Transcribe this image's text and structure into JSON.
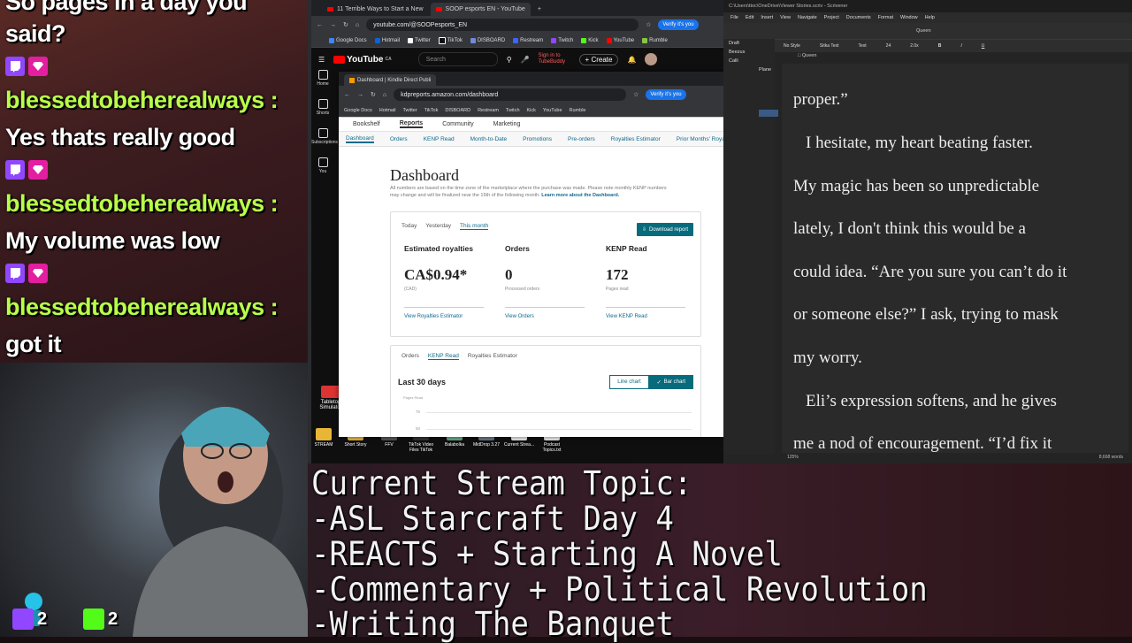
{
  "chat": {
    "partial_top": "So pages in a day you",
    "messages": [
      {
        "text_before": "said?"
      },
      {
        "user": "blessedtobeherealways :",
        "text": "Yes thats really good"
      },
      {
        "user": "blessedtobeherealways :",
        "text": "My volume was low"
      },
      {
        "user": "blessedtobeherealways :",
        "text": "got it"
      }
    ]
  },
  "stream_topic": {
    "lines": [
      "Current Stream Topic:",
      "-ASL Starcraft Day 4",
      "-REACTS + Starting A Novel",
      "-Commentary + Political Revolution",
      "-Writing The Banquet"
    ]
  },
  "stream_counts": {
    "twitch": "2",
    "kick": "2"
  },
  "youtube_browser": {
    "tabs": [
      "11 Terrible Ways to Start a New",
      "SOOP esports EN - YouTube"
    ],
    "url": "youtube.com/@SOOPesports_EN",
    "verify_label": "Verify it's you",
    "bookmarks": [
      "Google Docs",
      "Hotmail",
      "Twitter",
      "TikTok",
      "DISBOARD",
      "Restream",
      "Twitch",
      "Kick",
      "YouTube",
      "Rumble"
    ],
    "logo": "YouTube",
    "logo_region": "CA",
    "search_placeholder": "Search",
    "signin_text": "Sign in to TubeBuddy",
    "create_label": "Create",
    "sidebar": [
      "Home",
      "Shorts",
      "Subscriptions",
      "You"
    ]
  },
  "kdp_browser": {
    "tab_title": "Dashboard | Kindle Direct Publi",
    "url": "kdpreports.amazon.com/dashboard",
    "verify_label": "Verify it's you",
    "bookmarks": [
      "Google Docs",
      "Hotmail",
      "Twitter",
      "TikTok",
      "DISBOARD",
      "Restream",
      "Twitch",
      "Kick",
      "YouTube",
      "Rumble"
    ],
    "top_nav": [
      "Bookshelf",
      "Reports",
      "Community",
      "Marketing"
    ],
    "sub_nav": [
      "Dashboard",
      "Orders",
      "KENP Read",
      "Month-to-Date",
      "Promotions",
      "Pre-orders",
      "Royalties Estimator",
      "Prior Months' Royalties"
    ],
    "title": "Dashboard",
    "description": "All numbers are based on the time zone of the marketplace where the purchase was made. Please note monthly KENP numbers may change and will be finalized near the 15th of the following month.",
    "learn_more": "Learn more about the Dashboard.",
    "range_tabs": [
      "Today",
      "Yesterday",
      "This month"
    ],
    "download_label": "Download report",
    "metrics": [
      {
        "label": "Estimated royalties",
        "value": "CA$0.94*",
        "sub": "(CAD)",
        "link": "View Royalties Estimator"
      },
      {
        "label": "Orders",
        "value": "0",
        "sub": "Processed orders",
        "link": "View Orders"
      },
      {
        "label": "KENP Read",
        "value": "172",
        "sub": "Pages read",
        "link": "View KENP Read"
      }
    ],
    "chart_tabs": [
      "Orders",
      "KENP Read",
      "Royalties Estimator"
    ],
    "chart_title": "Last 30 days",
    "line_chart_label": "Line chart",
    "bar_chart_label": "Bar chart",
    "chart_axis_label": "Pages Read",
    "chart_ticks": [
      "75",
      "50"
    ]
  },
  "desktop_icons": [
    "Tabletop Simulator",
    "STREAM",
    "Short Story",
    "FFV",
    "TikTok Video Files TikTok",
    "Balabolka",
    "MidDrop 3.27",
    "Current Strea...",
    "Podcast Topics.txt"
  ],
  "scrivener": {
    "title_path": "C:\\Users\\ttoc\\OneDrive\\Viewer Stories.scriv - Scrivener",
    "menu": [
      "File",
      "Edit",
      "Insert",
      "View",
      "Navigate",
      "Project",
      "Documents",
      "Format",
      "Window",
      "Help"
    ],
    "doc_name": "Queen",
    "style": "No Style",
    "font": "Sitka Text",
    "font_style": "Text",
    "font_size": "24",
    "line_spacing": "2.0x",
    "binder": [
      "Draft",
      "Beezus",
      "Calli",
      "Plane"
    ],
    "prose_lines": [
      "proper.”",
      "I hesitate, my heart beating faster.",
      "My magic has been so unpredictable",
      "lately, I don't think this would be a",
      "could idea. “Are you sure you can’t do it",
      "or someone else?” I ask, trying to mask",
      "my worry.",
      "Eli’s expression softens, and he gives",
      "me a nod of encouragement. “I’d fix it"
    ],
    "zoom": "125%",
    "word_count": "8,668 words"
  }
}
